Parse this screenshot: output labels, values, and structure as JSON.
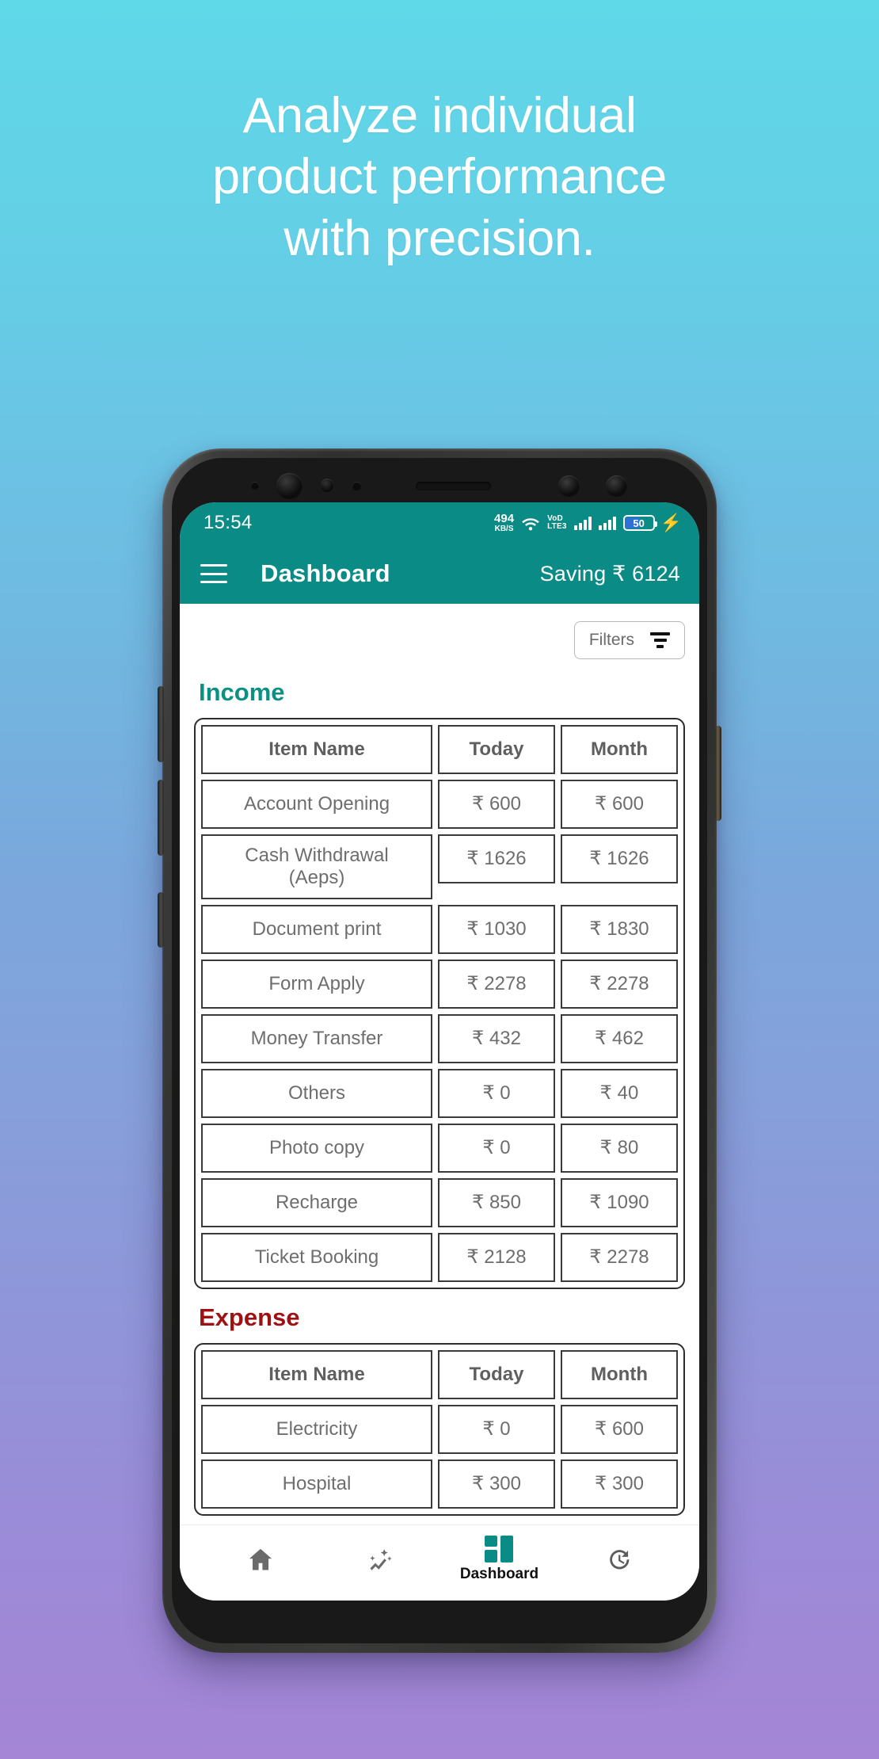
{
  "promo": {
    "headline_lines": [
      "Analyze individual",
      "product performance",
      "with precision."
    ]
  },
  "colors": {
    "teal": "#0b8b86",
    "income_green": "#0b9184",
    "expense_red": "#9e1214",
    "battery_blue": "#2f6fd8",
    "bolt_purple": "#4a5cf0"
  },
  "status_bar": {
    "time": "15:54",
    "net_speed_value": "494",
    "net_speed_unit": "KB/S",
    "wifi_icon": "wifi-icon",
    "volte_line1": "VoD",
    "volte_line2": "LTE3",
    "signal_1_icon": "signal-bars-icon",
    "signal_2_icon": "signal-bars-icon",
    "battery_level": "50",
    "charging_icon": "charging-bolt-icon"
  },
  "app_bar": {
    "menu_icon": "hamburger-menu-icon",
    "title": "Dashboard",
    "saving_label": "Saving ₹ 6124"
  },
  "toolbar": {
    "filters_label": "Filters",
    "filters_icon": "filter-funnel-icon"
  },
  "income": {
    "title": "Income",
    "columns": [
      "Item Name",
      "Today",
      "Month"
    ],
    "rows": [
      {
        "name": "Account Opening",
        "today": "₹ 600",
        "month": "₹ 600"
      },
      {
        "name": "Cash Withdrawal\n(Aeps)",
        "today": "₹ 1626",
        "month": "₹ 1626"
      },
      {
        "name": "Document print",
        "today": "₹ 1030",
        "month": "₹ 1830"
      },
      {
        "name": "Form Apply",
        "today": "₹ 2278",
        "month": "₹ 2278"
      },
      {
        "name": "Money Transfer",
        "today": "₹ 432",
        "month": "₹ 462"
      },
      {
        "name": "Others",
        "today": "₹ 0",
        "month": "₹ 40"
      },
      {
        "name": "Photo copy",
        "today": "₹ 0",
        "month": "₹ 80"
      },
      {
        "name": "Recharge",
        "today": "₹ 850",
        "month": "₹ 1090"
      },
      {
        "name": "Ticket Booking",
        "today": "₹ 2128",
        "month": "₹ 2278"
      }
    ]
  },
  "expense": {
    "title": "Expense",
    "columns": [
      "Item Name",
      "Today",
      "Month"
    ],
    "rows": [
      {
        "name": "Electricity",
        "today": "₹ 0",
        "month": "₹ 600"
      },
      {
        "name": "Hospital",
        "today": "₹ 300",
        "month": "₹ 300"
      }
    ]
  },
  "bottom_nav": {
    "items": [
      {
        "icon": "home-icon",
        "label": "",
        "active": false
      },
      {
        "icon": "auto-graph-icon",
        "label": "",
        "active": false
      },
      {
        "icon": "dashboard-grid-icon",
        "label": "Dashboard",
        "active": true
      },
      {
        "icon": "history-clock-icon",
        "label": "",
        "active": false
      }
    ]
  }
}
